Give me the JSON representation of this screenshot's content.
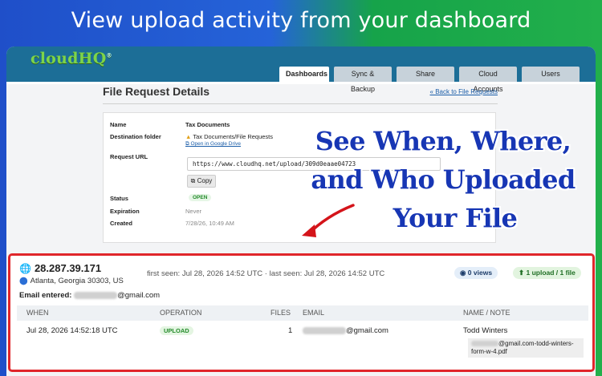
{
  "headline": "View upload activity from your dashboard",
  "logo": {
    "text": "cloudHQ",
    "mark": "®"
  },
  "tabs": [
    {
      "label": "Dashboards",
      "active": true
    },
    {
      "label": "Sync & Backup",
      "active": false
    },
    {
      "label": "Share",
      "active": false
    },
    {
      "label": "Cloud Accounts",
      "active": false
    },
    {
      "label": "Users",
      "active": false
    }
  ],
  "page": {
    "title": "File Request Details",
    "back_link": "« Back to File Requests"
  },
  "details": {
    "name_label": "Name",
    "name_value": "Tax Documents",
    "dest_label": "Destination folder",
    "dest_value": "Tax Documents/File Requests",
    "open_drive": "Open in Google Drive",
    "url_label": "Request URL",
    "url_value": "https://www.cloudhq.net/upload/309d0eaae04723",
    "copy_label": "Copy",
    "status_label": "Status",
    "status_value": "OPEN",
    "expiration_label": "Expiration",
    "expiration_value": "Never",
    "created_label": "Created",
    "created_value": "7/28/26, 10:49 AM"
  },
  "overlay": {
    "line1": "See When, Where,",
    "line2": "and Who Uploaded",
    "line3": "Your File"
  },
  "activity": {
    "ip": "28.287.39.171",
    "location": "Atlanta, Georgia 30303, US",
    "seen": "first seen: Jul 28, 2026 14:52 UTC  ·  last seen: Jul 28, 2026 14:52 UTC",
    "views": "0 views",
    "uploads": "1 upload / 1 file",
    "email_label": "Email entered:",
    "email_domain": "@gmail.com",
    "columns": {
      "when": "WHEN",
      "operation": "OPERATION",
      "files": "FILES",
      "email": "EMAIL",
      "name_note": "NAME / NOTE"
    },
    "row": {
      "when": "Jul 28, 2026 14:52:18 UTC",
      "operation": "UPLOAD",
      "files": "1",
      "email_domain": "@gmail.com",
      "name": "Todd Winters",
      "file_tail": "@gmail.com-todd-winters-form-w-4.pdf"
    }
  },
  "colors": {
    "accent_red": "#e0262b",
    "overlay_blue": "#1736b4",
    "topbar": "#1c6e97",
    "logo_green": "#7dd44a"
  },
  "icons": [
    "globe-icon",
    "map-pin-icon",
    "eye-icon",
    "upload-icon",
    "copy-icon",
    "drive-icon",
    "external-link-icon",
    "red-arrow-icon"
  ]
}
